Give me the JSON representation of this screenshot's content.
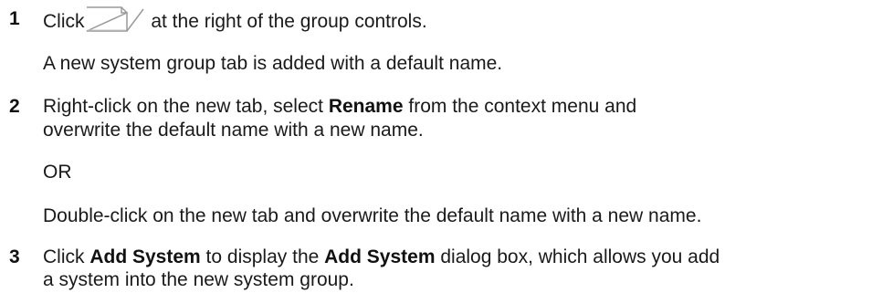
{
  "steps": [
    {
      "number": "1",
      "before_icon": "Click",
      "icon": "new-tab-icon",
      "after_icon": " at the right of the group controls.",
      "note": "A new system group tab is added with a default name."
    },
    {
      "number": "2",
      "text_a": "Right-click on the new tab, select ",
      "bold_a": "Rename",
      "text_b": " from the context menu and",
      "line2": "overwrite the default name with a new name.",
      "or": "OR",
      "alt": "Double-click on the new tab and overwrite the default name with a new name."
    },
    {
      "number": "3",
      "text_a": "Click ",
      "bold_a": "Add System",
      "text_b": " to display the ",
      "bold_b": "Add System",
      "text_c": " dialog box, which allows you add",
      "line2": "a system into the new system group."
    }
  ],
  "colors": {
    "text": "#1a1a1a",
    "icon_stroke": "#9a9a9a"
  }
}
